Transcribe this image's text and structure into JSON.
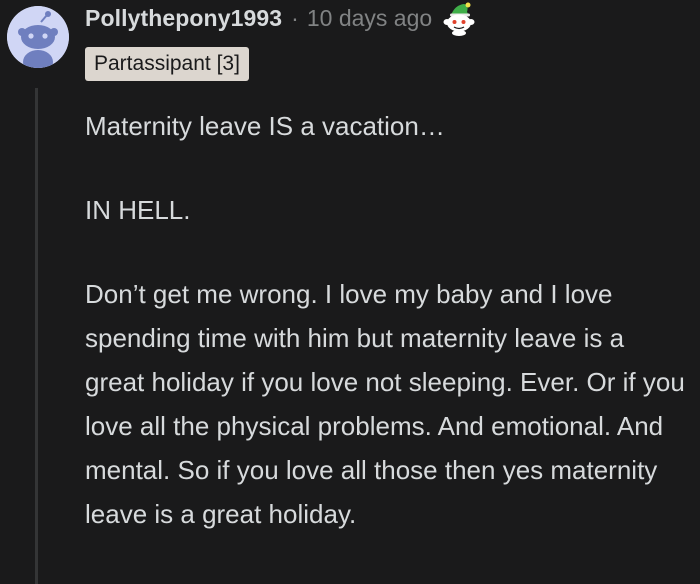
{
  "comment": {
    "username": "Pollythepony1993",
    "separator": "·",
    "timestamp": "10 days ago",
    "award_icon": "snoo-elf-award-icon",
    "avatar_icon": "snoo-avatar-icon",
    "flair": "Partassipant [3]",
    "paragraphs": [
      "Maternity leave IS a vacation…",
      "IN HELL.",
      "Don’t get me wrong. I love my baby and I love spending time with him but maternity leave is a great holiday if you love not sleeping. Ever. Or if you love all the physical problems. And emotional. And mental. So if you love all those then yes maternity leave is a great holiday."
    ]
  },
  "colors": {
    "background": "#1a1a1b",
    "text": "#d7dadc",
    "muted": "#818384",
    "flair_bg": "#dcd6cf",
    "avatar_bg": "#d0d6f5",
    "thread_line": "#343536"
  }
}
